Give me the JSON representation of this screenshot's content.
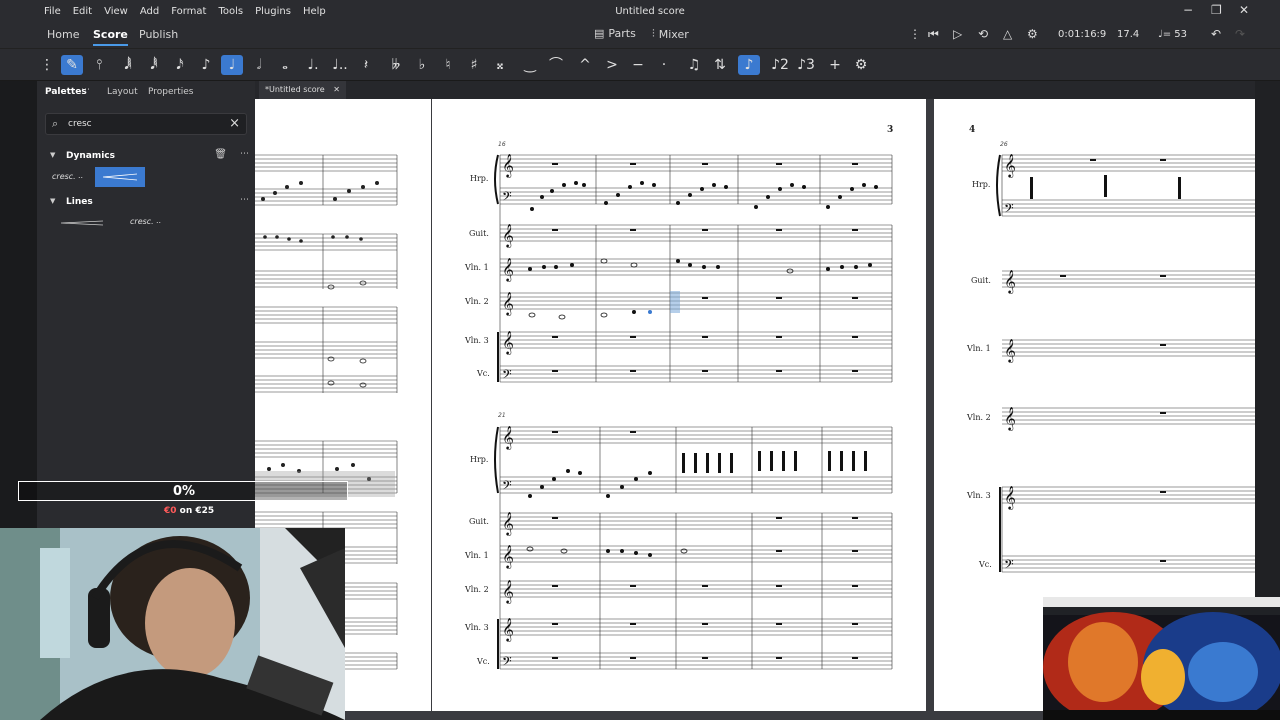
{
  "menubar": {
    "items": [
      "File",
      "Edit",
      "View",
      "Add",
      "Format",
      "Tools",
      "Plugins",
      "Help"
    ],
    "title": "Untitled score"
  },
  "tabs": {
    "home": "Home",
    "score": "Score",
    "publish": "Publish"
  },
  "tab_tools": {
    "parts": "Parts",
    "mixer": "Mixer"
  },
  "playback": {
    "time": "0:01:16:9",
    "position": "17.4",
    "tempo": "= 53"
  },
  "palette": {
    "tabs": [
      "Palettes",
      "Layout",
      "Properties"
    ],
    "search_value": "cresc",
    "sections": [
      {
        "label": "Dynamics",
        "cell_text": "cresc."
      },
      {
        "label": "Lines",
        "cell_text": "cresc."
      }
    ]
  },
  "score_tab": "*Untitled score",
  "score": {
    "page_numbers": [
      "3",
      "4"
    ],
    "measure_numbers": [
      "16",
      "21",
      "26"
    ],
    "instruments": [
      "Hrp.",
      "Guit.",
      "Vln. 1",
      "Vln. 2",
      "Vln. 3",
      "Vc."
    ]
  },
  "overlay": {
    "progress_text": "0%",
    "goal_current": "€0",
    "goal_rest": " on €25",
    "progress_fraction": 0
  },
  "colors": {
    "accent": "#3b7ad0",
    "chrome": "#2b2c30",
    "page": "#ffffff"
  }
}
